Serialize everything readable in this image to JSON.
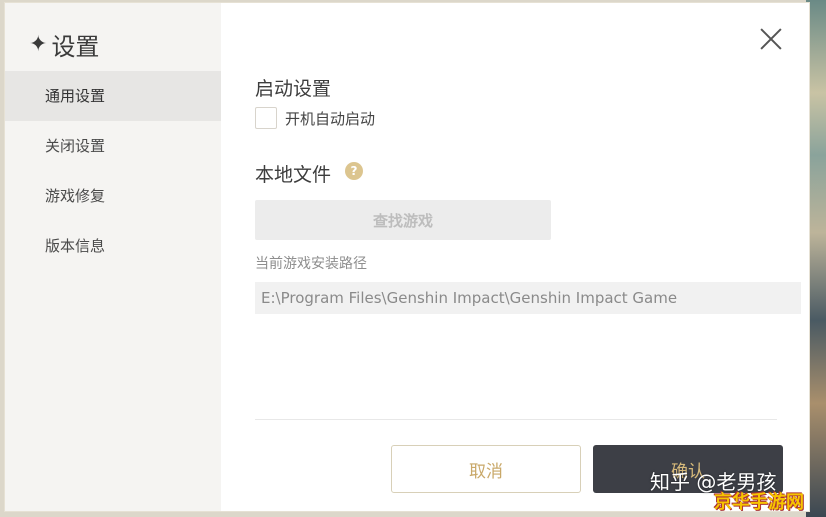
{
  "title": "设置",
  "sidebar": {
    "items": [
      {
        "label": "通用设置"
      },
      {
        "label": "关闭设置"
      },
      {
        "label": "游戏修复"
      },
      {
        "label": "版本信息"
      }
    ]
  },
  "startup": {
    "title": "启动设置",
    "autostart_label": "开机自动启动",
    "autostart_checked": false
  },
  "local_files": {
    "title": "本地文件",
    "help_icon": "question-mark",
    "find_button": "查找游戏",
    "path_label": "当前游戏安装路径",
    "path_value": "E:\\Program Files\\Genshin Impact\\Genshin Impact Game"
  },
  "footer": {
    "cancel_label": "取消",
    "confirm_label": "确认"
  },
  "watermarks": {
    "zhihu": "知乎 @老男孩",
    "site": "京华手游网"
  },
  "colors": {
    "accent_gold": "#c9a869",
    "confirm_bg": "#3d3f46",
    "help_icon": "#dcc58f"
  }
}
